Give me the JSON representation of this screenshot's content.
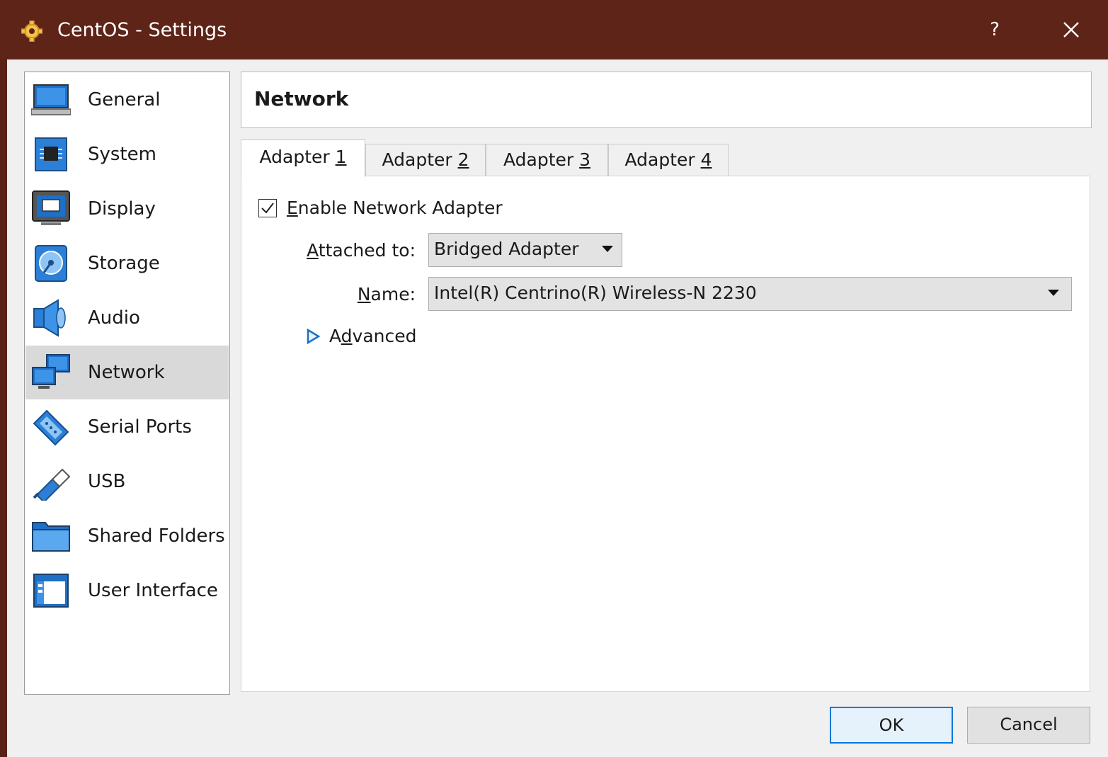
{
  "window": {
    "title": "CentOS - Settings",
    "help_label": "?",
    "titlebar_color": "#5d2417"
  },
  "sidebar": {
    "items": [
      {
        "label": "General",
        "icon": "monitor-icon"
      },
      {
        "label": "System",
        "icon": "chip-icon"
      },
      {
        "label": "Display",
        "icon": "display-icon"
      },
      {
        "label": "Storage",
        "icon": "disk-icon"
      },
      {
        "label": "Audio",
        "icon": "speaker-icon"
      },
      {
        "label": "Network",
        "icon": "network-icon",
        "selected": true
      },
      {
        "label": "Serial Ports",
        "icon": "serial-port-icon"
      },
      {
        "label": "USB",
        "icon": "usb-icon"
      },
      {
        "label": "Shared Folders",
        "icon": "folder-icon"
      },
      {
        "label": "User Interface",
        "icon": "window-icon"
      }
    ]
  },
  "page": {
    "title": "Network"
  },
  "tabs": [
    {
      "prefix": "Adapter ",
      "key": "1",
      "active": true
    },
    {
      "prefix": "Adapter ",
      "key": "2"
    },
    {
      "prefix": "Adapter ",
      "key": "3"
    },
    {
      "prefix": "Adapter ",
      "key": "4"
    }
  ],
  "adapter": {
    "enable": {
      "key": "E",
      "rest": "nable Network Adapter",
      "checked": true
    },
    "attached_to": {
      "key": "A",
      "rest": "ttached to:",
      "value": "Bridged Adapter"
    },
    "name": {
      "key": "N",
      "rest": "ame:",
      "value": "Intel(R) Centrino(R) Wireless-N 2230"
    },
    "advanced": {
      "pre": "A",
      "key": "d",
      "rest": "vanced"
    }
  },
  "buttons": {
    "ok": "OK",
    "cancel": "Cancel"
  },
  "colors": {
    "accent": "#0078d7",
    "selected_bg": "#d9d9d9"
  }
}
